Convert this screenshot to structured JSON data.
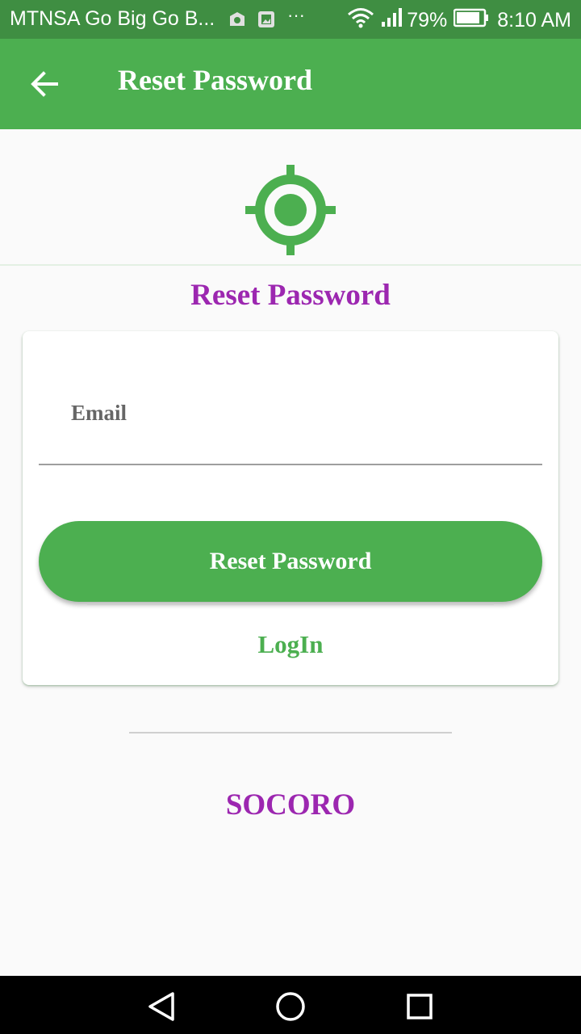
{
  "status_bar": {
    "carrier": "MTNSA Go Big Go B...",
    "more": "···",
    "battery_percent": "79%",
    "time": "8:10 AM",
    "icons": [
      "vpn-icon",
      "gallery-notification-icon",
      "wifi-icon",
      "signal-icon",
      "battery-icon"
    ]
  },
  "app_bar": {
    "title": "Reset Password",
    "back_icon": "arrow-left-icon"
  },
  "logo_icon": "crosshair-target-icon",
  "heading": "Reset Password",
  "form": {
    "email_label": "Email",
    "email_value": "",
    "submit_label": "Reset Password",
    "login_link": "LogIn"
  },
  "brand": "SOCORO",
  "nav_bar": {
    "icons": [
      "back-triangle-icon",
      "home-circle-icon",
      "recents-square-icon"
    ]
  },
  "colors": {
    "primary": "#4caf50",
    "primary_dark": "#3f8e42",
    "accent": "#9c27b0"
  }
}
